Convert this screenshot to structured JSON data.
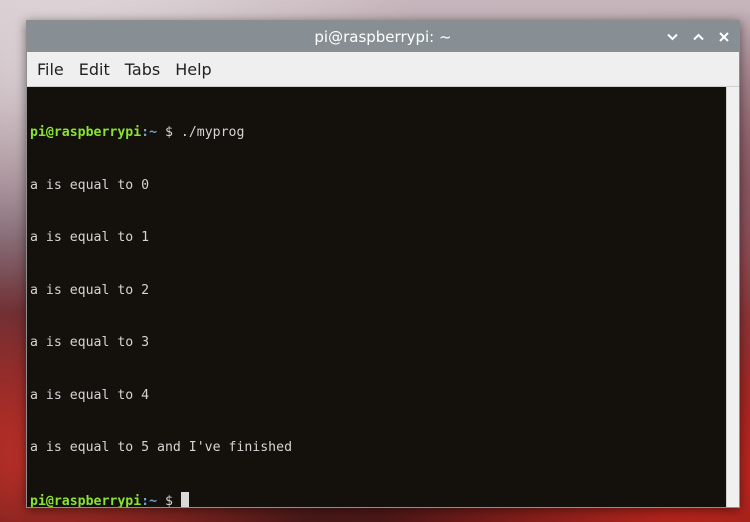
{
  "window": {
    "title": "pi@raspberrypi: ~",
    "controls": [
      {
        "name": "minimize-button",
        "icon": "chevron-down-icon",
        "glyph": "⌄"
      },
      {
        "name": "maximize-button",
        "icon": "chevron-up-icon",
        "glyph": "⌃"
      },
      {
        "name": "close-button",
        "icon": "close-icon",
        "glyph": "✕"
      }
    ]
  },
  "menu": {
    "file": "File",
    "edit": "Edit",
    "tabs": "Tabs",
    "help": "Help"
  },
  "terminal": {
    "prompt": {
      "user": "pi@raspberrypi",
      "path": ":~",
      "symbol": " $ "
    },
    "command": "./myprog",
    "output": [
      "a is equal to 0",
      "a is equal to 1",
      "a is equal to 2",
      "a is equal to 3",
      "a is equal to 4",
      "a is equal to 5 and I've finished"
    ]
  },
  "colors": {
    "prompt_user": "#8ae234",
    "prompt_path": "#729fcf",
    "terminal_bg": "#14110c",
    "titlebar_bg": "#878f94"
  }
}
